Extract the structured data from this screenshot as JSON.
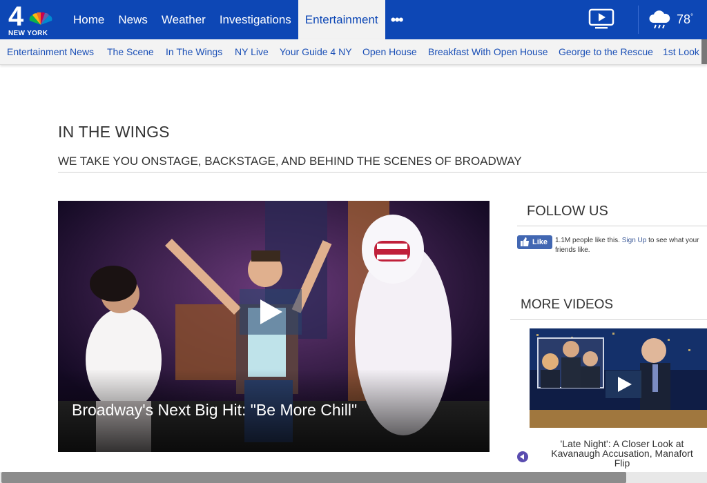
{
  "header": {
    "logo_number": "4",
    "logo_city": "NEW YORK",
    "nav": [
      "Home",
      "News",
      "Weather",
      "Investigations",
      "Entertainment"
    ],
    "active_nav": "Entertainment",
    "more_label": "•••",
    "temperature": "78",
    "temperature_unit": "°",
    "weather_icon": "rain-cloud-icon",
    "video_icon": "tv-play-icon"
  },
  "subnav": [
    "Entertainment News",
    "The Scene",
    "In The Wings",
    "NY Live",
    "Your Guide 4 NY",
    "Open House",
    "Breakfast With Open House",
    "George to the Rescue",
    "1st Look"
  ],
  "section": {
    "title": "IN THE WINGS",
    "subtitle": "WE TAKE YOU ONSTAGE, BACKSTAGE, AND BEHIND THE SCENES OF BROADWAY"
  },
  "hero": {
    "title": "Broadway's Next Big Hit: \"Be More Chill\""
  },
  "follow": {
    "title": "FOLLOW US",
    "like_label": "Like",
    "count_text": "1.1M people like this.",
    "signup_link": "Sign Up",
    "rest_text": " to see what your",
    "second_line": "friends like."
  },
  "more_videos": {
    "title": "MORE VIDEOS",
    "caption": "'Late Night': A Closer Look at Kavanaugh Accusation, Manafort Flip"
  },
  "colors": {
    "brand_blue": "#0d47b5",
    "link_blue": "#1a4fb6",
    "facebook_blue": "#4267b2"
  }
}
